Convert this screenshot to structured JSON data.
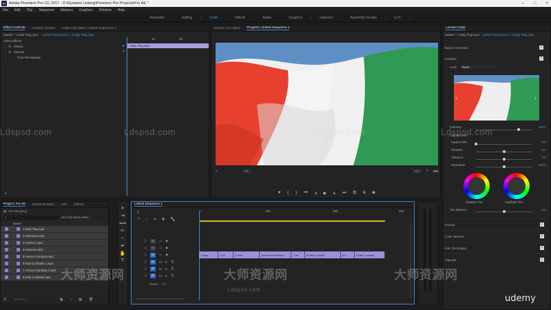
{
  "app": {
    "title": "Adobe Premiere Pro CC 2017 - D:\\Dynamic Linking\\Premiere Pro Projects\\For AE *",
    "logo": "Pr",
    "window_controls": [
      "–",
      "□",
      "×"
    ]
  },
  "menu": [
    "File",
    "Edit",
    "Clip",
    "Sequence",
    "Markers",
    "Graphics",
    "Window",
    "Help"
  ],
  "workspaces": [
    {
      "label": "Assembly",
      "active": false
    },
    {
      "label": "Editing",
      "active": false
    },
    {
      "label": "Color",
      "active": true
    },
    {
      "label": "Effects",
      "active": false
    },
    {
      "label": "Audio",
      "active": false
    },
    {
      "label": "Graphics",
      "active": false
    },
    {
      "label": "Libraries",
      "active": false
    },
    {
      "label": "Assembly Double",
      "active": false
    },
    {
      "label": "LUT",
      "active": false
    }
  ],
  "effect_controls": {
    "tabs": [
      "Effect Controls",
      "Lumetri Scopes",
      "Audio Clip Mixer: Linked Sequence 1"
    ],
    "master": "Master * 1-Italy Flag.mp4",
    "sequence": "Linked Sequence 1 * 1-Italy Flag.mp4",
    "section": "Video Effects",
    "effects": [
      "Motion",
      "Opacity",
      "Time Remapping"
    ],
    "timecode_marks": [
      "15",
      "20"
    ],
    "mini_clip": "1-Italy Flag.mp4",
    "bottom_timecode": "0"
  },
  "source_monitor": {
    "tabs": [
      "Source: (no clips)",
      "Program: Linked Sequence 1"
    ],
    "fit": "Fit",
    "zoom": "1/2",
    "time": "0",
    "frame": "408"
  },
  "lumetri": {
    "title": "Lumetri Color",
    "master": "Master * 1-Italy Flag.mp4",
    "sequence": "Linked Sequence 1 * 1-Italy Flag.mp4",
    "sections": {
      "basic": "Basic Correction",
      "creative": "Creative"
    },
    "look_label": "Look",
    "look_value": "None",
    "intensity": {
      "label": "Intensity",
      "value": "100.0",
      "level": 0.75
    },
    "adjustments_label": "Adjustments",
    "adjust": [
      {
        "label": "Faded Film",
        "value": "0.0",
        "level": 0.0
      },
      {
        "label": "Sharpen",
        "value": "0.0",
        "level": 0.5
      },
      {
        "label": "Vibrance",
        "value": "0.0",
        "level": 0.5
      },
      {
        "label": "Saturation",
        "value": "100.0",
        "level": 0.5
      }
    ],
    "shadow_tint": "Shadow Tint",
    "highlight_tint": "Highlight Tint",
    "tint_balance": {
      "label": "Tint Balance",
      "value": "0.0",
      "level": 0.5
    },
    "more_sections": [
      "Curves",
      "Color Wheels",
      "HSL Secondary",
      "Vignette"
    ]
  },
  "project": {
    "tabs": [
      "Project: For AE",
      "Media Browser",
      "Info",
      "Effects"
    ],
    "path": "For AE.prproj",
    "count": "18 of 11 items selec...",
    "name_header": "Name",
    "items": [
      "1-Italy Flag.mp4",
      "2-Olympics.mp4",
      "3-Venice1.mp4",
      "4-Venice2.mp4",
      "5-Venice Gondola.mp4",
      "6-Italy Cocktails 1.mp4",
      "7-Venice Gondola 2.mp4",
      "8-Italy Cocktails.mp4"
    ]
  },
  "timeline": {
    "tab": "Linked Sequence 1",
    "timecode": "0",
    "ruler": [
      "0",
      "150",
      "300",
      "450"
    ],
    "video_tracks": [
      "V3",
      "V2",
      "V1"
    ],
    "audio_tracks": [
      "A1",
      "A2",
      "A3"
    ],
    "master": "Master",
    "master_value": "0.0",
    "clips": [
      "1-Italy",
      "2-Ol",
      "3-Veni",
      "10-Venice Restaur",
      "7-Ve",
      "8-Italy Cocktail",
      "6-It",
      "9-Italy Cocktail"
    ]
  },
  "watermarks": [
    "Ldspsd.com",
    "Ldspsd.com",
    "Ldspsd.com",
    "Ldspsd.com",
    "Ldspsd.com"
  ],
  "watermark_cn": "大师资源网",
  "udemy": "udemy"
}
